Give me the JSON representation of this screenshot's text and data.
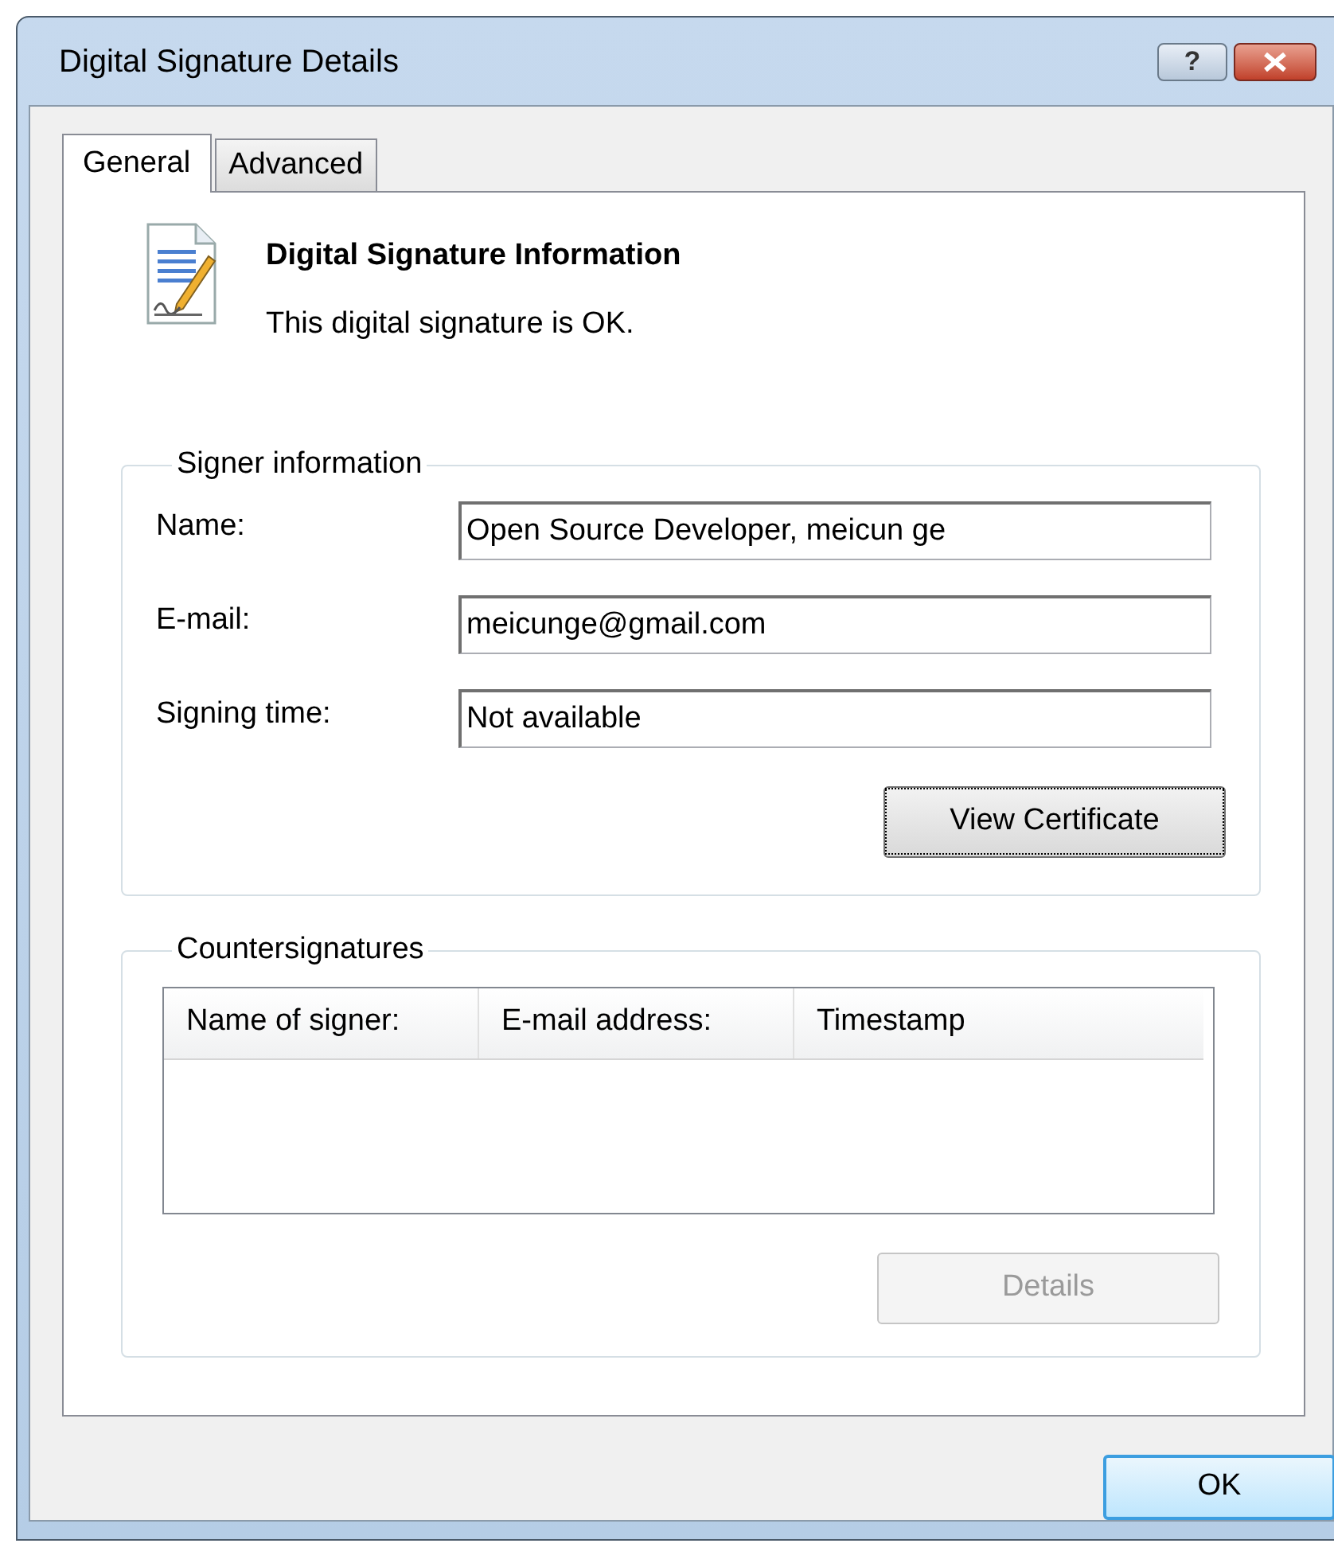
{
  "window": {
    "title": "Digital Signature Details",
    "controls": [
      {
        "kind": "help",
        "label": "?"
      },
      {
        "kind": "close"
      }
    ]
  },
  "tabs": [
    {
      "label": "General",
      "selected": true
    },
    {
      "label": "Advanced",
      "selected": false
    }
  ],
  "header": {
    "title": "Digital Signature Information",
    "status": "This digital signature is OK."
  },
  "signer_information": {
    "title": "Signer information",
    "fields": [
      {
        "label": "Name:",
        "value": "Open Source Developer, meicun ge"
      },
      {
        "label": "E-mail:",
        "value": "meicunge@gmail.com"
      },
      {
        "label": "Signing time:",
        "value": "Not available"
      }
    ],
    "button": {
      "label": "View Certificate",
      "disabled": false,
      "focused": true
    }
  },
  "countersignatures": {
    "title": "Countersignatures",
    "table": {
      "columns": [
        "Name of signer:",
        "E-mail address:",
        "Timestamp"
      ]
    },
    "button": {
      "label": "Details",
      "disabled": true,
      "focused": false
    }
  },
  "footer": {
    "button": {
      "label": "OK",
      "disabled": false,
      "focused": false
    }
  }
}
